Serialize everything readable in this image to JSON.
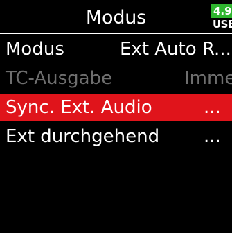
{
  "header": {
    "title": "Modus",
    "battery": {
      "level": "4.9",
      "type": "USB",
      "color": "#2fb52f"
    }
  },
  "menu": {
    "items": [
      {
        "label": "Modus",
        "value": "Ext Auto R...",
        "enabled": true,
        "selected": false
      },
      {
        "label": "TC-Ausgabe",
        "value": "Immer",
        "enabled": false,
        "selected": false
      },
      {
        "label": "Sync. Ext. Audio",
        "value": "...",
        "enabled": true,
        "selected": true
      },
      {
        "label": "Ext durchgehend",
        "value": "...",
        "enabled": true,
        "selected": false
      }
    ],
    "selected_color": "#e0141b",
    "disabled_color": "#6e6e6e"
  }
}
